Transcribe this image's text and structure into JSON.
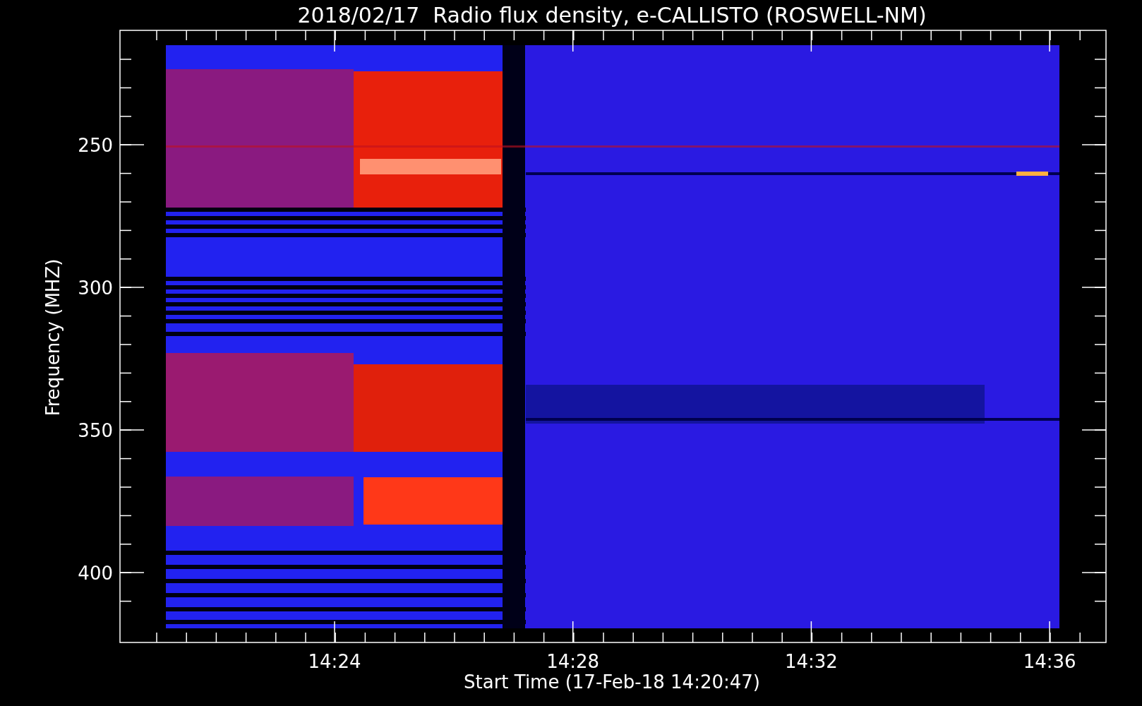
{
  "title": "2018/02/17  Radio flux density, e-CALLISTO (ROSWELL-NM)",
  "y_axis": {
    "label": "Frequency (MHZ)",
    "ticks": [
      "250",
      "300",
      "350",
      "400"
    ]
  },
  "x_axis": {
    "label": "Start Time (17-Feb-18 14:20:47)",
    "ticks": [
      "14:24",
      "14:28",
      "14:32",
      "14:36"
    ]
  }
}
